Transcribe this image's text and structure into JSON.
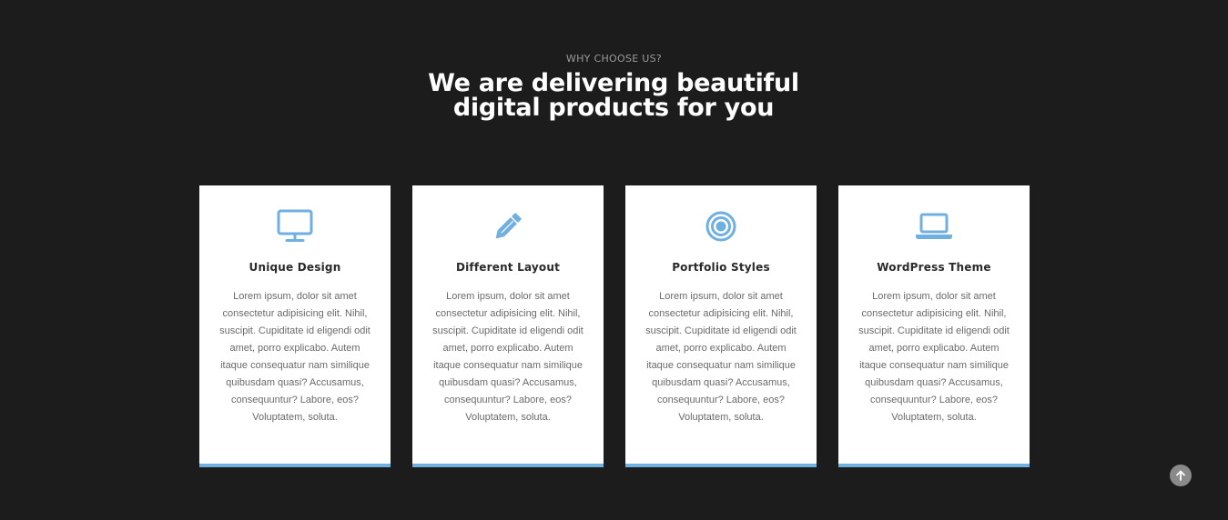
{
  "section": {
    "eyebrow": "WHY CHOOSE US?",
    "headline": "We are delivering beautiful digital products for you"
  },
  "features": [
    {
      "icon": "desktop-monitor-icon",
      "title": "Unique Design",
      "description": "Lorem ipsum, dolor sit amet consectetur adipisicing elit. Nihil, suscipit. Cupiditate id eligendi odit amet, porro explicabo. Autem itaque consequatur nam similique quibusdam quasi? Accusamus, consequuntur? Labore, eos? Voluptatem, soluta."
    },
    {
      "icon": "pencil-icon",
      "title": "Different Layout",
      "description": "Lorem ipsum, dolor sit amet consectetur adipisicing elit. Nihil, suscipit. Cupiditate id eligendi odit amet, porro explicabo. Autem itaque consequatur nam similique quibusdam quasi? Accusamus, consequuntur? Labore, eos? Voluptatem, soluta."
    },
    {
      "icon": "target-icon",
      "title": "Portfolio Styles",
      "description": "Lorem ipsum, dolor sit amet consectetur adipisicing elit. Nihil, suscipit. Cupiditate id eligendi odit amet, porro explicabo. Autem itaque consequatur nam similique quibusdam quasi? Accusamus, consequuntur? Labore, eos? Voluptatem, soluta."
    },
    {
      "icon": "laptop-icon",
      "title": "WordPress Theme",
      "description": "Lorem ipsum, dolor sit amet consectetur adipisicing elit. Nihil, suscipit. Cupiditate id eligendi odit amet, porro explicabo. Autem itaque consequatur nam similique quibusdam quasi? Accusamus, consequuntur? Labore, eos? Voluptatem, soluta."
    }
  ],
  "scroll_top": {
    "icon": "arrow-up-icon"
  },
  "colors": {
    "background": "#1c1c1c",
    "card": "#ffffff",
    "accent": "#6fb0e0",
    "heading": "#ffffff",
    "eyebrow": "#9a9a9a"
  }
}
